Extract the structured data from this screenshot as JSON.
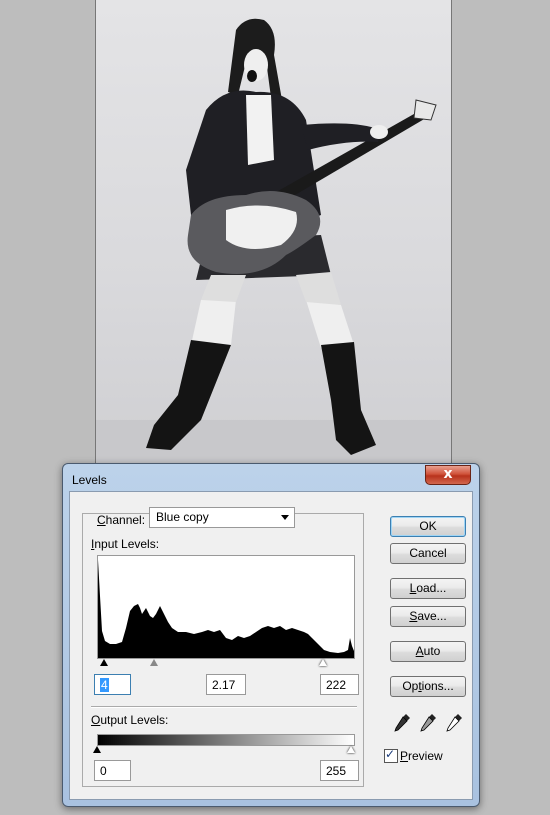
{
  "dialog": {
    "title": "Levels",
    "close_label": "x"
  },
  "channel": {
    "label": "Channel:",
    "label_mnemonic": "C",
    "label_rest": "hannel:",
    "selected": "Blue copy"
  },
  "input_levels": {
    "label_mnemonic": "I",
    "label_rest": "nput Levels:",
    "black": "4",
    "gamma": "2.17",
    "white": "222"
  },
  "output_levels": {
    "label_mnemonic": "O",
    "label_rest": "utput Levels:",
    "black": "0",
    "white": "255"
  },
  "buttons": {
    "ok": "OK",
    "cancel": "Cancel",
    "load": "Load...",
    "load_mnemonic": "L",
    "load_rest": "oad...",
    "save": "Save...",
    "save_mnemonic": "S",
    "save_rest": "ave...",
    "auto": "Auto",
    "auto_mnemonic": "A",
    "auto_rest": "uto",
    "options": "Options...",
    "options_mnemonic": "t",
    "options_pre": "Op",
    "options_rest": "ions..."
  },
  "preview": {
    "label_mnemonic": "P",
    "label_rest": "review",
    "checked": true
  },
  "icons": [
    "close-icon",
    "dropdown-arrow-icon",
    "black-point-eyedropper-icon",
    "gray-point-eyedropper-icon",
    "white-point-eyedropper-icon",
    "checkmark-icon"
  ],
  "colors": {
    "titlebar": "#bcd2ea",
    "close": "#c9452c",
    "default_button_border": "#3c7fb1"
  }
}
